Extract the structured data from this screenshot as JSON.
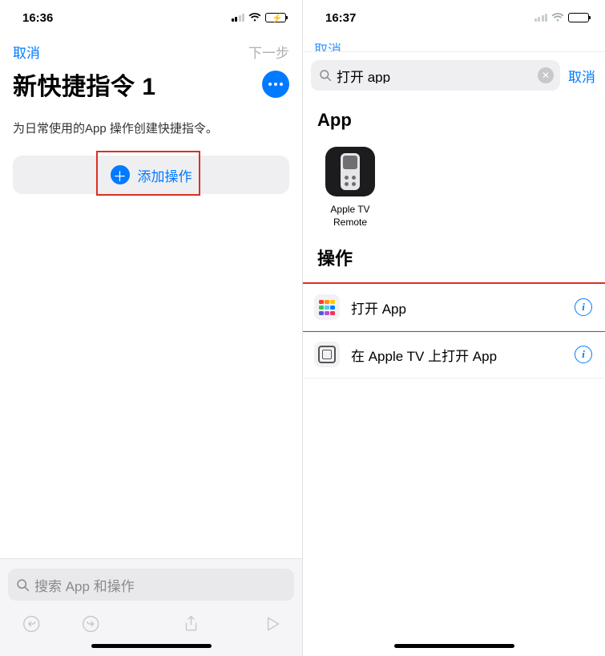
{
  "left": {
    "time": "16:36",
    "nav": {
      "cancel": "取消",
      "next": "下一步"
    },
    "title": "新快捷指令 1",
    "subtitle": "为日常使用的App 操作创建快捷指令。",
    "add_action": "添加操作",
    "search_placeholder": "搜索 App 和操作"
  },
  "right": {
    "time": "16:37",
    "obscured_cancel": "取消",
    "search_value": "打开 app",
    "cancel": "取消",
    "section_app": "App",
    "app_tile": {
      "name": "Apple TV Remote"
    },
    "section_actions": "操作",
    "actions": [
      {
        "label": "打开 App"
      },
      {
        "label": "在 Apple TV 上打开 App"
      }
    ]
  }
}
